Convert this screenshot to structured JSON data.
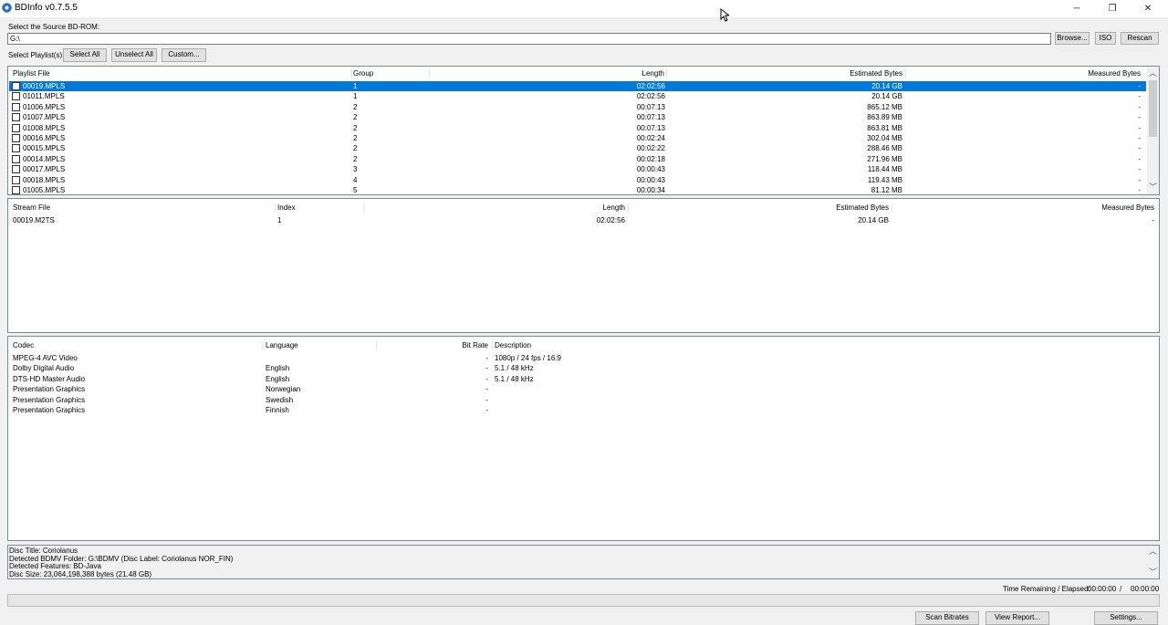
{
  "window": {
    "title": "BDInfo v0.7.5.5",
    "controls": [
      "─",
      "❐",
      "✕"
    ]
  },
  "source": {
    "label": "Select the Source BD-ROM:",
    "path": "G:\\",
    "browse": "Browse...",
    "iso": "ISO",
    "rescan": "Rescan"
  },
  "playlist_select": {
    "label": "Select Playlist(s):",
    "select_all": "Select All",
    "unselect_all": "Unselect All",
    "custom": "Custom..."
  },
  "playlists": {
    "headers": [
      "Playlist File",
      "Group",
      "Length",
      "Estimated Bytes",
      "Measured Bytes"
    ],
    "rows": [
      {
        "file": "00019.MPLS",
        "group": "1",
        "length": "02:02:56",
        "est": "20.14 GB",
        "meas": "-",
        "selected": true
      },
      {
        "file": "01011.MPLS",
        "group": "1",
        "length": "02:02:56",
        "est": "20.14 GB",
        "meas": "-"
      },
      {
        "file": "01006.MPLS",
        "group": "2",
        "length": "00:07:13",
        "est": "865.12 MB",
        "meas": "-"
      },
      {
        "file": "01007.MPLS",
        "group": "2",
        "length": "00:07:13",
        "est": "863.89 MB",
        "meas": "-"
      },
      {
        "file": "01008.MPLS",
        "group": "2",
        "length": "00:07:13",
        "est": "863.81 MB",
        "meas": "-"
      },
      {
        "file": "00016.MPLS",
        "group": "2",
        "length": "00:02:24",
        "est": "302.04 MB",
        "meas": "-"
      },
      {
        "file": "00015.MPLS",
        "group": "2",
        "length": "00:02:22",
        "est": "288.46 MB",
        "meas": "-"
      },
      {
        "file": "00014.MPLS",
        "group": "2",
        "length": "00:02:18",
        "est": "271.96 MB",
        "meas": "-"
      },
      {
        "file": "00017.MPLS",
        "group": "3",
        "length": "00:00:43",
        "est": "118.44 MB",
        "meas": "-"
      },
      {
        "file": "00018.MPLS",
        "group": "4",
        "length": "00:00:43",
        "est": "119.43 MB",
        "meas": "-"
      },
      {
        "file": "01005.MPLS",
        "group": "5",
        "length": "00:00:34",
        "est": "81.12 MB",
        "meas": "-"
      }
    ]
  },
  "streams": {
    "headers": [
      "Stream File",
      "Index",
      "Length",
      "Estimated Bytes",
      "Measured Bytes"
    ],
    "rows": [
      {
        "file": "00019.M2TS",
        "index": "1",
        "length": "02:02:56",
        "est": "20.14 GB",
        "meas": "-"
      }
    ]
  },
  "codecs": {
    "headers": [
      "Codec",
      "Language",
      "Bit Rate",
      "Description"
    ],
    "rows": [
      {
        "codec": "MPEG-4 AVC Video",
        "language": "",
        "bitrate": "-",
        "desc": "1080p / 24 fps / 16:9"
      },
      {
        "codec": "Dolby Digital Audio",
        "language": "English",
        "bitrate": "-",
        "desc": "5.1 / 48 kHz"
      },
      {
        "codec": "DTS-HD Master Audio",
        "language": "English",
        "bitrate": "-",
        "desc": "5.1 / 48 kHz"
      },
      {
        "codec": "Presentation Graphics",
        "language": "Norwegian",
        "bitrate": "-",
        "desc": ""
      },
      {
        "codec": "Presentation Graphics",
        "language": "Swedish",
        "bitrate": "-",
        "desc": ""
      },
      {
        "codec": "Presentation Graphics",
        "language": "Finnish",
        "bitrate": "-",
        "desc": ""
      }
    ]
  },
  "disc_info": [
    "Disc Title: Coriolanus",
    "Detected BDMV Folder: G:\\BDMV (Disc Label: Coriolanus NOR_FIN)",
    "Detected Features: BD-Java",
    "Disc Size: 23,064,198,388 bytes (21.48 GB)"
  ],
  "status": {
    "time_label": "Time Remaining / Elapsed:",
    "remaining": "00:00:00",
    "slash": "/",
    "elapsed": "00:00:00",
    "progress": 0
  },
  "footer": {
    "scan": "Scan Bitrates",
    "report": "View Report...",
    "settings": "Settings..."
  }
}
